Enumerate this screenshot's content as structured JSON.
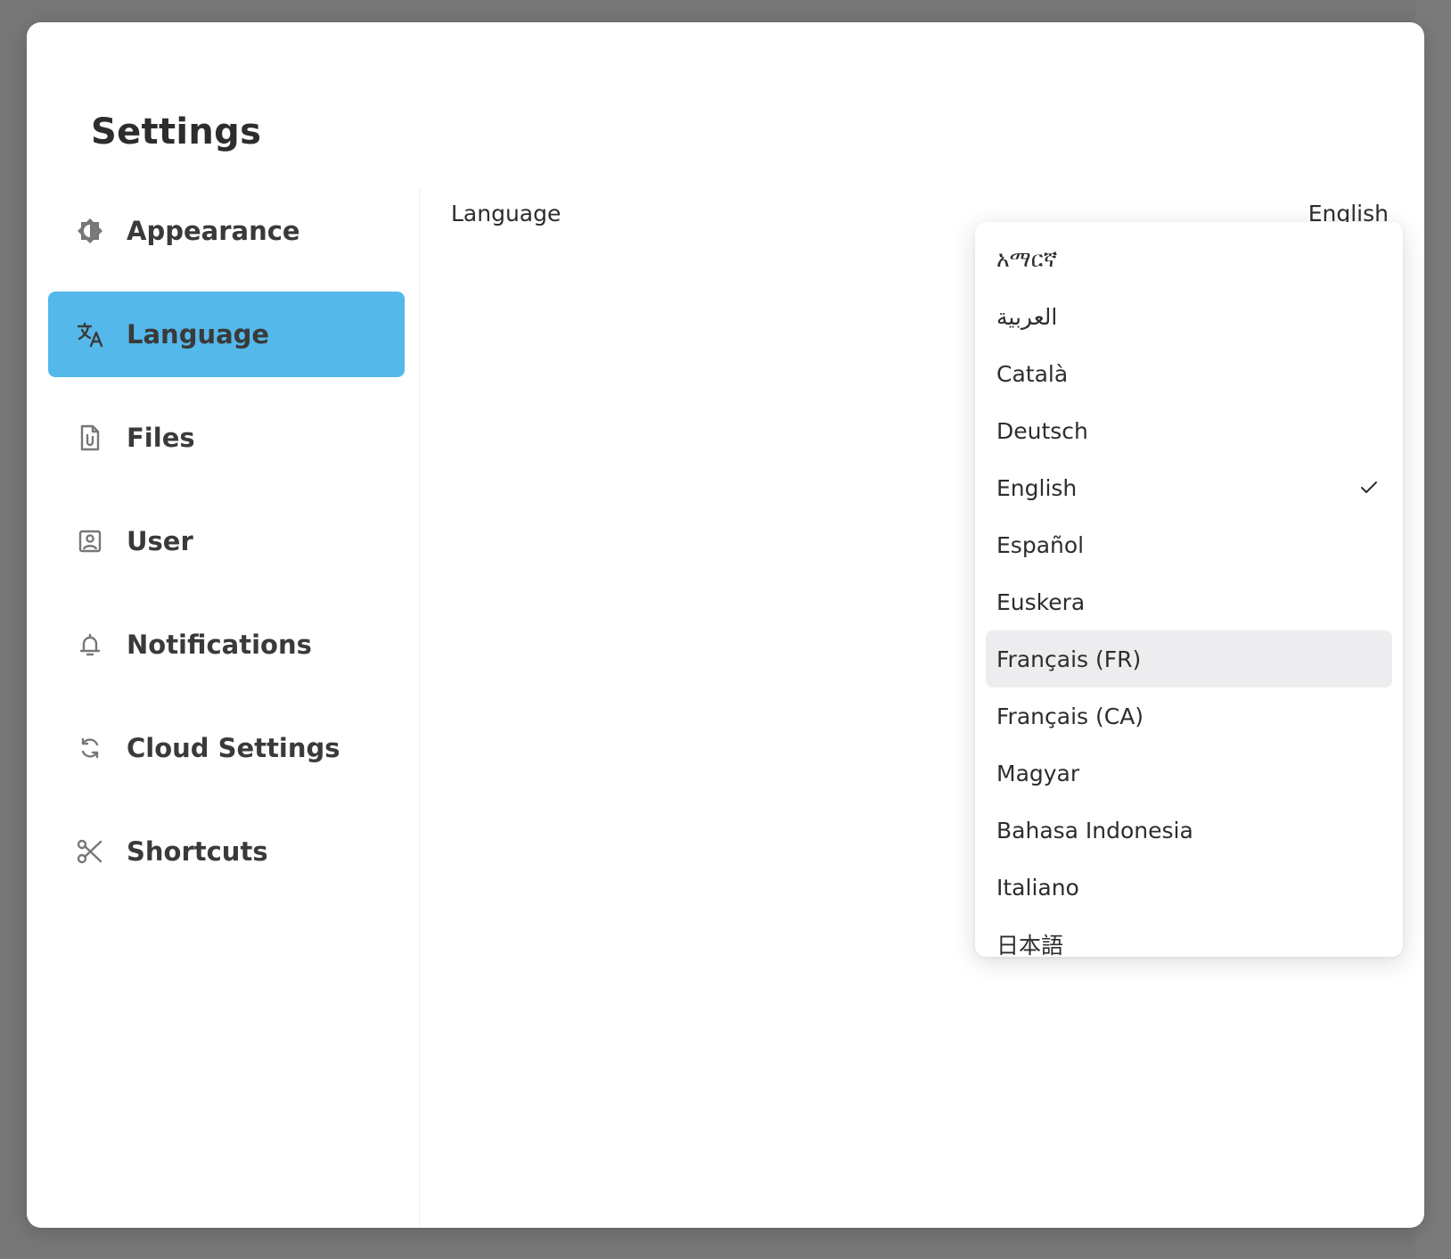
{
  "modal": {
    "title": "Settings"
  },
  "sidebar": {
    "items": [
      {
        "label": "Appearance",
        "icon": "brightness-icon",
        "active": false
      },
      {
        "label": "Language",
        "icon": "translate-icon",
        "active": true
      },
      {
        "label": "Files",
        "icon": "file-icon",
        "active": false
      },
      {
        "label": "User",
        "icon": "user-icon",
        "active": false
      },
      {
        "label": "Notifications",
        "icon": "bell-icon",
        "active": false
      },
      {
        "label": "Cloud Settings",
        "icon": "sync-icon",
        "active": false
      },
      {
        "label": "Shortcuts",
        "icon": "scissors-icon",
        "active": false
      }
    ],
    "active_color": "#55b8ea"
  },
  "language_setting": {
    "label": "Language",
    "selected_value": "English"
  },
  "language_dropdown": {
    "options": [
      "አማርኛ",
      "العربية",
      "Català",
      "Deutsch",
      "English",
      "Español",
      "Euskera",
      "Français (FR)",
      "Français (CA)",
      "Magyar",
      "Bahasa Indonesia",
      "Italiano",
      "日本語"
    ],
    "selected_option": "English",
    "hovered_option": "Français (FR)",
    "check_icon": "check-icon"
  }
}
